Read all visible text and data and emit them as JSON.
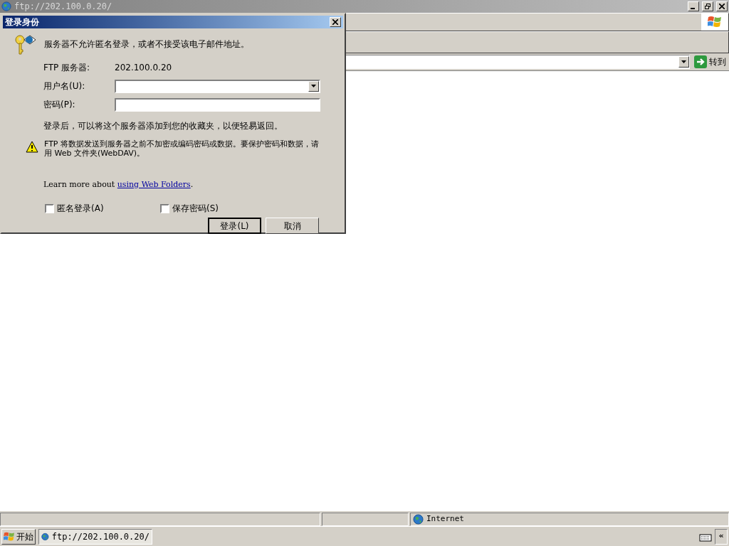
{
  "window": {
    "title": "ftp://202.100.0.20/"
  },
  "address_bar": {
    "go_button": "转到"
  },
  "dialog": {
    "title": "登录身份",
    "message": "服务器不允许匿名登录，或者不接受该电子邮件地址。",
    "fields": [
      {
        "kind": "static",
        "label": "FTP 服务器:",
        "value": "202.100.0.20"
      },
      {
        "kind": "combo",
        "label": "用户名(U):"
      },
      {
        "kind": "password",
        "label": "密码(P):"
      }
    ],
    "note": "登录后，可以将这个服务器添加到您的收藏夹，以便轻易返回。",
    "warning": "FTP 将数据发送到服务器之前不加密或编码密码或数据。要保护密码和数据，请用 Web 文件夹(WebDAV)。",
    "learn_more": {
      "text": "Learn more about",
      "link": "using Web Folders",
      "after": "."
    },
    "checkboxes": [
      {
        "label": "匿名登录(A)",
        "checked": false
      },
      {
        "label": "保存密码(S)",
        "checked": false
      }
    ],
    "buttons": [
      {
        "label": "登录(L)",
        "default": true
      },
      {
        "label": "取消",
        "default": false
      }
    ]
  },
  "status_bar": {
    "zone": "Internet"
  },
  "taskbar": {
    "start": "开始",
    "tasks": [
      {
        "label": "ftp://202.100.0.20/",
        "selected": true
      }
    ],
    "tray_toggle": "«"
  }
}
